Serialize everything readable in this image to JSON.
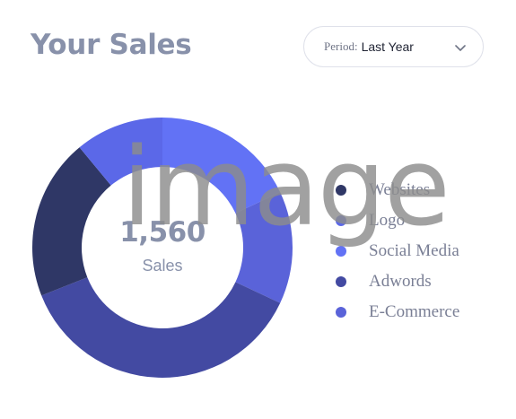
{
  "header": {
    "title": "Your Sales",
    "period_label": "Period:",
    "period_value": "Last Year"
  },
  "icons": {
    "period_dropdown": "chevron-down-icon"
  },
  "summary": {
    "total": "1,560",
    "label": "Sales"
  },
  "legend": [
    {
      "label": "Websites",
      "color": "#2f3766"
    },
    {
      "label": "Logo",
      "color": "#5b68e8"
    },
    {
      "label": "Social Media",
      "color": "#6272f5"
    },
    {
      "label": "Adwords",
      "color": "#434aa2"
    },
    {
      "label": "E-Commerce",
      "color": "#5a63d9"
    }
  ],
  "watermark": "image",
  "chart_data": {
    "type": "pie",
    "categories": [
      "Websites",
      "Logo",
      "Social Media",
      "Adwords",
      "E-Commerce"
    ],
    "values": [
      20,
      11,
      18,
      37,
      14
    ],
    "colors": [
      "#2f3766",
      "#5b68e8",
      "#6272f5",
      "#434aa2",
      "#5a63d9"
    ]
  }
}
